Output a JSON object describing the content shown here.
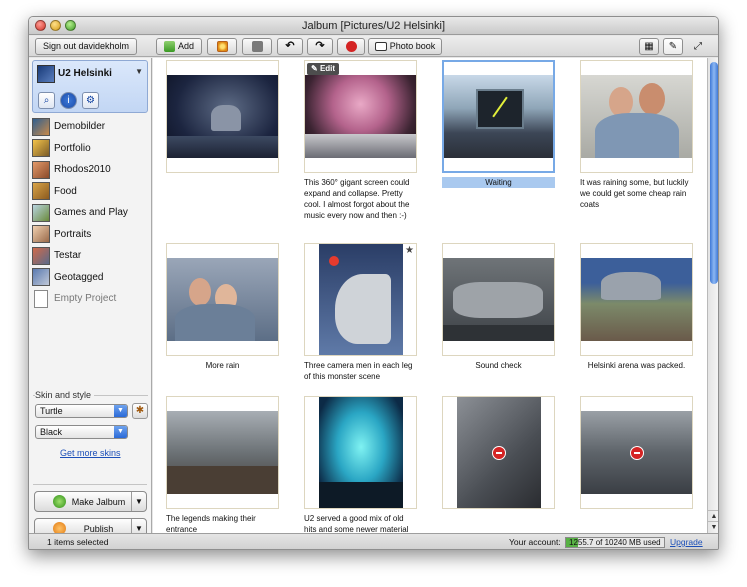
{
  "window": {
    "title": "Jalbum [Pictures/U2 Helsinki]"
  },
  "toolbar": {
    "sign_out": "Sign out davidekholm",
    "add": "Add",
    "photo_book": "Photo book"
  },
  "project": {
    "name": "U2 Helsinki"
  },
  "sidebar": {
    "items": [
      {
        "label": "Demobilder"
      },
      {
        "label": "Portfolio"
      },
      {
        "label": "Rhodos2010"
      },
      {
        "label": "Food"
      },
      {
        "label": "Games and Play"
      },
      {
        "label": "Portraits"
      },
      {
        "label": "Testar"
      },
      {
        "label": "Geotagged"
      },
      {
        "label": "Empty Project"
      }
    ]
  },
  "skin": {
    "heading": "Skin and style",
    "skin_value": "Turtle",
    "style_value": "Black",
    "get_more": "Get more skins"
  },
  "actions": {
    "make": "Make Jalbum",
    "publish": "Publish"
  },
  "grid": {
    "items": [
      {
        "caption": "",
        "edit_label": ""
      },
      {
        "caption": "This 360° gigant screen could expand and collapse. Pretty cool. I almost forgot about the music every now and then :-)",
        "edit_label": "Edit"
      },
      {
        "caption": "Waiting"
      },
      {
        "caption": "It was raining some, but luckily we could get some cheap rain coats"
      },
      {
        "caption": "More rain"
      },
      {
        "caption": "Three camera men in each leg of this monster scene"
      },
      {
        "caption": "Sound check"
      },
      {
        "caption": "Helsinki arena was packed."
      },
      {
        "caption": "The legends making their entrance"
      },
      {
        "caption": "U2 served a good mix of old hits and some newer material"
      },
      {
        "caption": ""
      },
      {
        "caption": ""
      }
    ]
  },
  "status": {
    "selected": "1 items selected",
    "account_label": "Your account:",
    "usage": "1255.7 of 10240 MB used",
    "usage_fraction": 0.1226,
    "upgrade": "Upgrade"
  }
}
